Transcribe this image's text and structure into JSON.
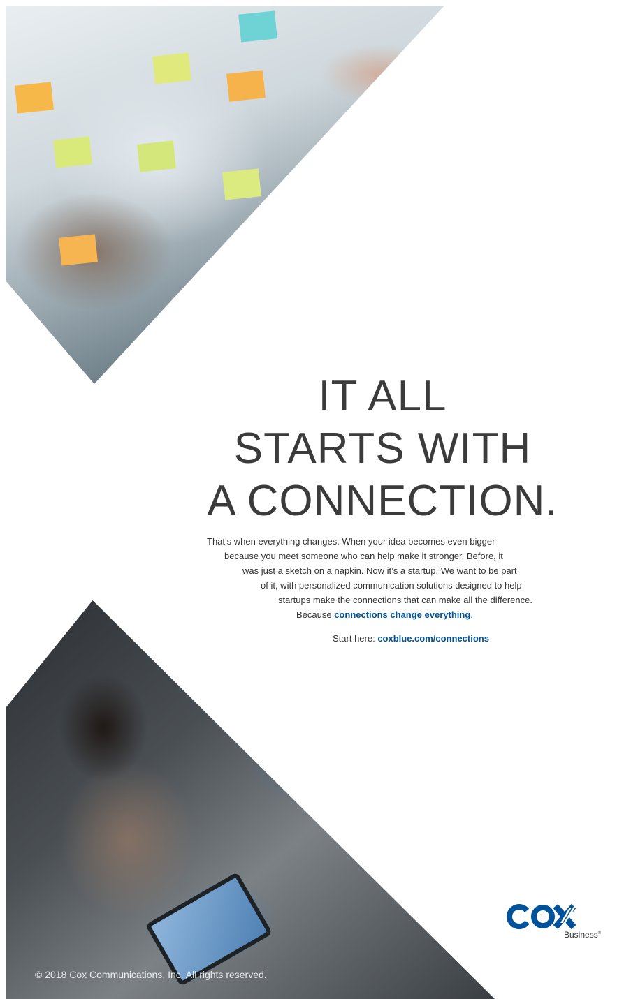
{
  "headline": {
    "line1": "IT ALL",
    "line2": "STARTS WITH",
    "line3": "A CONNECTION."
  },
  "body": {
    "line1": "That’s when everything changes. When your idea becomes even bigger",
    "line2": "because you meet someone who can help make it stronger. Before, it",
    "line3": "was just a sketch on a napkin. Now it’s a startup. We want to be part",
    "line4": "of it, with personalized communication solutions designed to help",
    "line5": "startups make the connections that can make all the difference.",
    "line6_prefix": "Because ",
    "line6_link": "connections change everything",
    "line6_suffix": "."
  },
  "cta": {
    "prefix": "Start here: ",
    "url": "coxblue.com/connections"
  },
  "logo": {
    "wordmark": "COX",
    "sub": "Business",
    "registered": "®",
    "color": "#00539b"
  },
  "copyright": "© 2018 Cox Communications, Inc. All rights reserved."
}
